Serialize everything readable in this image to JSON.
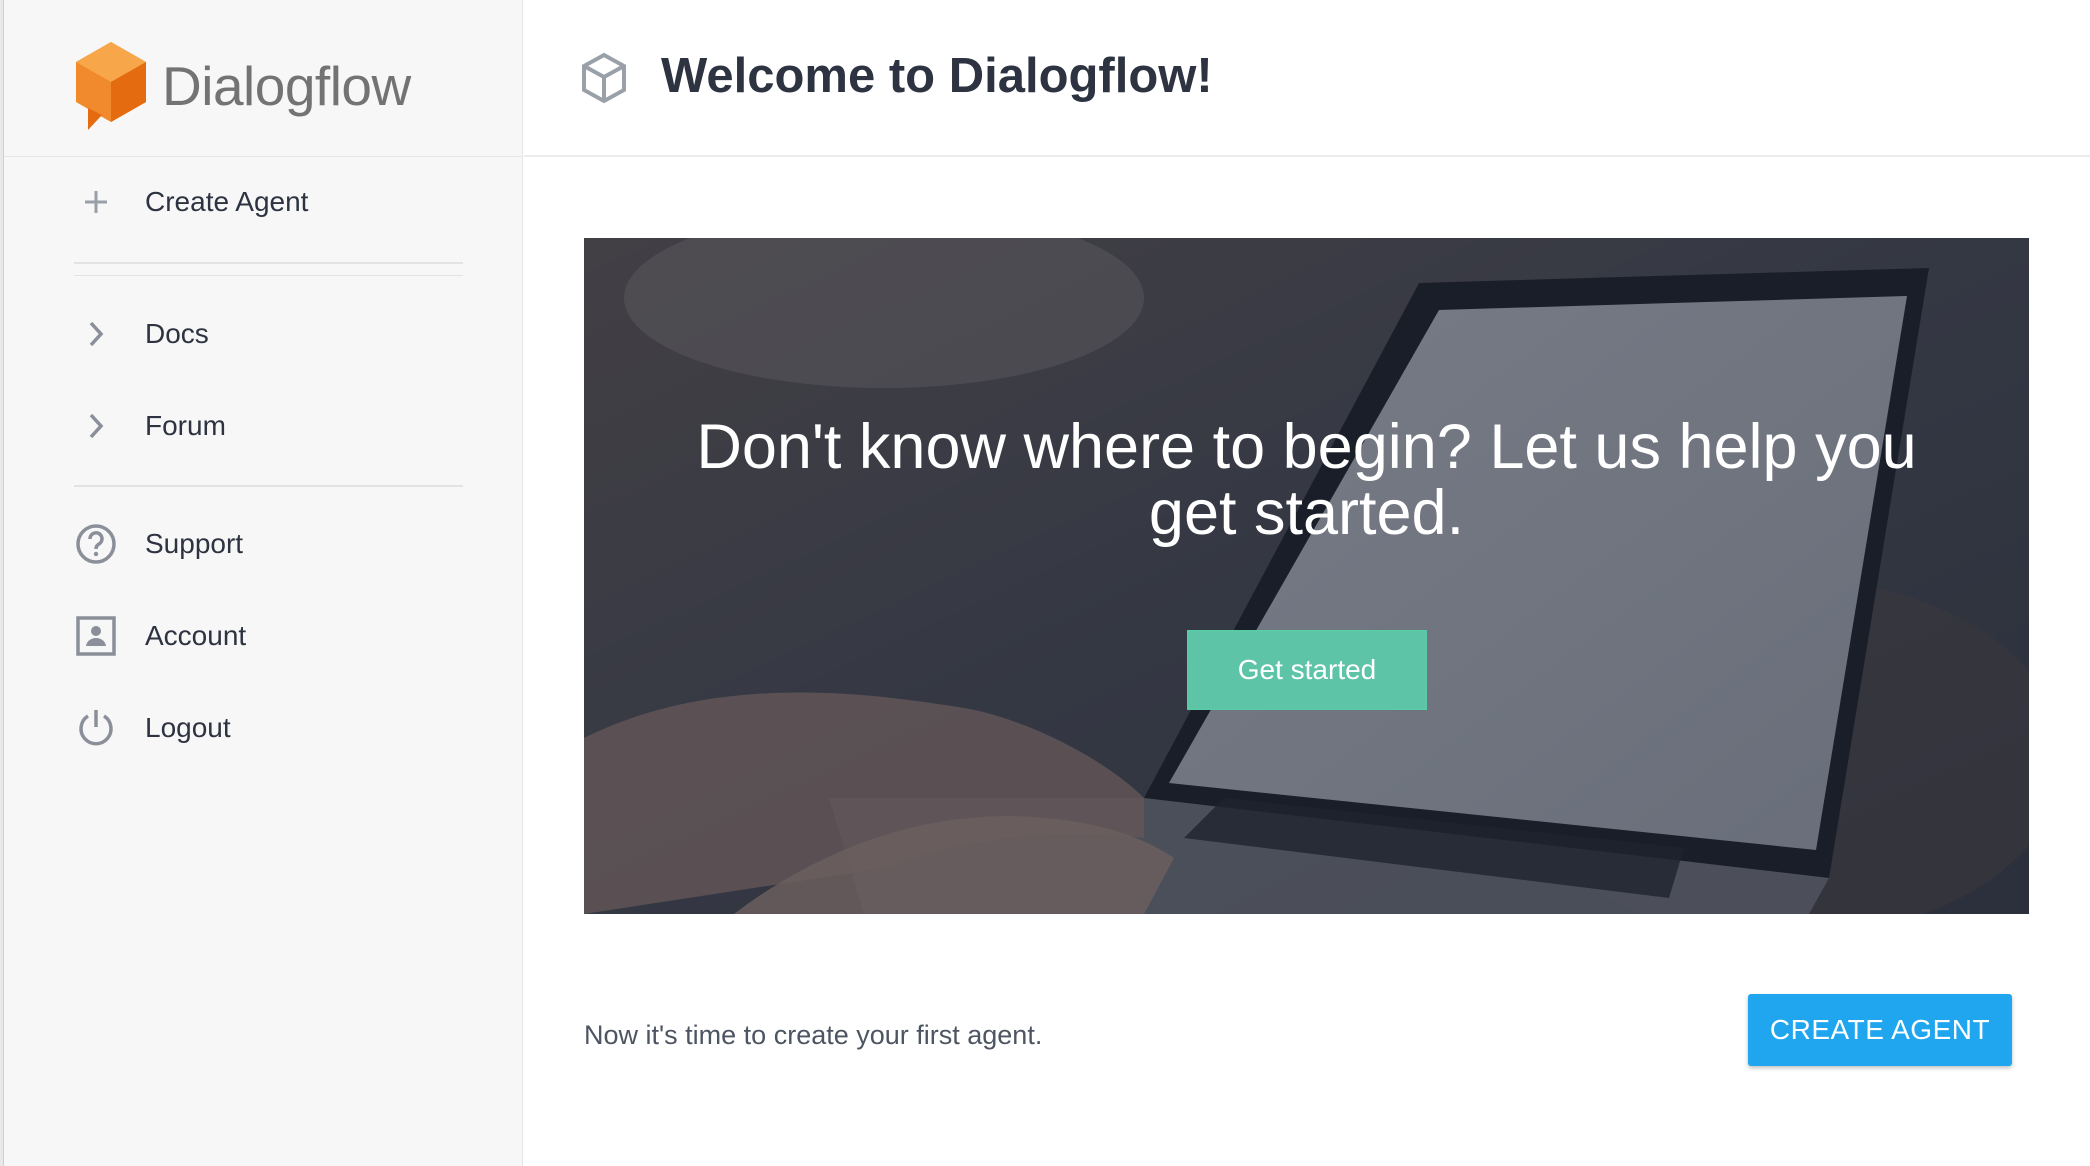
{
  "app": {
    "brand": "Dialogflow",
    "title": "Welcome to Dialogflow!"
  },
  "sidebar": {
    "create_agent_label": "Create Agent",
    "items": [
      {
        "label": "Docs",
        "icon": "chevron-right-icon"
      },
      {
        "label": "Forum",
        "icon": "chevron-right-icon"
      },
      {
        "label": "Support",
        "icon": "help-circle-icon"
      },
      {
        "label": "Account",
        "icon": "account-box-icon"
      },
      {
        "label": "Logout",
        "icon": "power-icon"
      }
    ]
  },
  "hero": {
    "headline": "Don't know where to begin? Let us help you get started.",
    "button_label": "Get started"
  },
  "footer": {
    "prompt": "Now it's time to create your first agent.",
    "create_button_label": "CREATE AGENT"
  },
  "colors": {
    "brand_orange": "#ef6c00",
    "accent_green": "#5ec4a7",
    "primary_blue": "#1fa6ef",
    "sidebar_bg": "#f7f7f7"
  }
}
